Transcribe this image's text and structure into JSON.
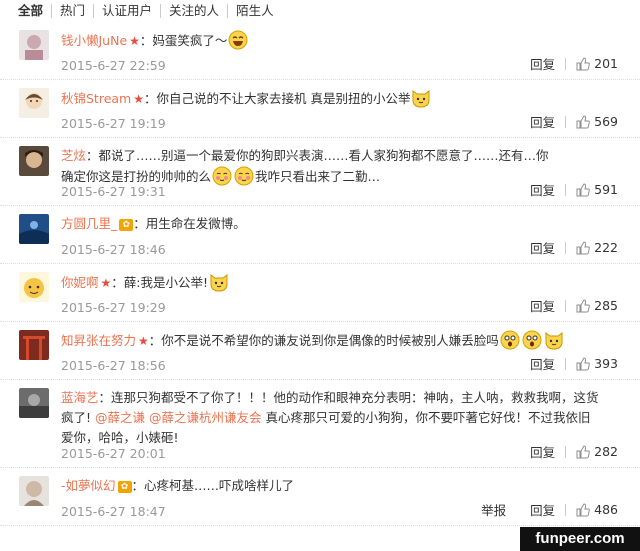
{
  "tabs": [
    "全部",
    "热门",
    "认证用户",
    "关注的人",
    "陌生人"
  ],
  "actions": {
    "reply": "回复",
    "report": "举报"
  },
  "comments": [
    {
      "user": "钱小懒JuNe",
      "badge": "star",
      "segments": [
        {
          "t": "：妈蛋笑疯了～"
        }
      ],
      "emojis": [
        "laugh"
      ],
      "time": "2015-6-27 22:59",
      "likes": "201"
    },
    {
      "user": "秋锦Stream",
      "badge": "star",
      "segments": [
        {
          "t": "：你自己说的不让大家去接机 真是别扭的小公举"
        }
      ],
      "emojis": [
        "cat"
      ],
      "time": "2015-6-27 19:19",
      "likes": "569"
    },
    {
      "user": "芝炫",
      "badge": "",
      "line1": "：都说了……别逼一个最爱你的狗即兴表演……看人家狗狗都不愿意了……还有…你",
      "line2": "确定你这是打扮的帅帅的么",
      "line2b": "我咋只看出来了二勤…",
      "time": "2015-6-27 19:31",
      "likes": "591"
    },
    {
      "user": "方圆几里_",
      "badge": "vip",
      "segments": [
        {
          "t": "：用生命在发微博。"
        }
      ],
      "time": "2015-6-27 18:46",
      "likes": "222"
    },
    {
      "user": "你妮啊",
      "badge": "star",
      "segments": [
        {
          "t": "：薛:我是小公举!"
        }
      ],
      "time": "2015-6-27 19:29",
      "likes": "285"
    },
    {
      "user": "知昇张在努力",
      "badge": "star",
      "segments": [
        {
          "t": "：你不是说不希望你的谦友说到你是偶像的时候被别人嫌丢脸吗"
        }
      ],
      "time": "2015-6-27 18:56",
      "likes": "393"
    },
    {
      "user": "蓝海艺",
      "badge": "",
      "line1": "：连那只狗都受不了你了！！！他的动作和眼神充分表明：神呐，主人呐，救救我啊，这货",
      "line2": "疯了!",
      "mention1": "@薛之谦",
      "mention2": "@薛之谦杭州谦友会",
      "line2b": " 真心疼那只可爱的小狗狗，你不要吓著它好伐！不过我依旧",
      "line3": "爱你，哈哈，小婊砸!",
      "time": "2015-6-27 20:01",
      "likes": "282"
    },
    {
      "user": "-如夢似幻",
      "badge": "vip",
      "segments": [
        {
          "t": "：心疼柯基……吓成啥样儿了"
        }
      ],
      "time": "2015-6-27 18:47",
      "likes": "486"
    }
  ],
  "watermark": "funpeer.com"
}
